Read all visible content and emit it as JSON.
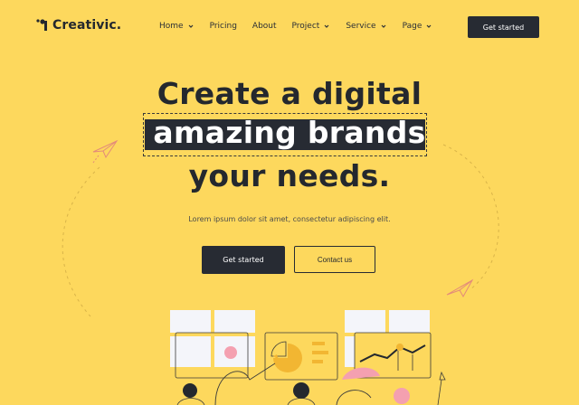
{
  "brand": {
    "name": "Creativic."
  },
  "nav": {
    "items": [
      {
        "label": "Home",
        "has_dropdown": true
      },
      {
        "label": "Pricing",
        "has_dropdown": false
      },
      {
        "label": "About",
        "has_dropdown": false
      },
      {
        "label": "Project",
        "has_dropdown": true
      },
      {
        "label": "Service",
        "has_dropdown": true
      },
      {
        "label": "Page",
        "has_dropdown": true
      }
    ],
    "cta_label": "Get started"
  },
  "hero": {
    "line1": "Create a digital",
    "line2_highlight": "amazing brands",
    "line3": "your needs.",
    "subtitle": "Lorem ipsum dolor sit amet, consectetur adipiscing elit.",
    "primary_button": "Get started",
    "secondary_button": "Contact us"
  },
  "icons": [
    "logo-icon",
    "chevron-down-icon",
    "paper-plane-icon"
  ],
  "colors": {
    "background": "#FDD85D",
    "dark": "#272B33",
    "white": "#FFFFFF",
    "accent_pink": "#F4A0B0"
  }
}
